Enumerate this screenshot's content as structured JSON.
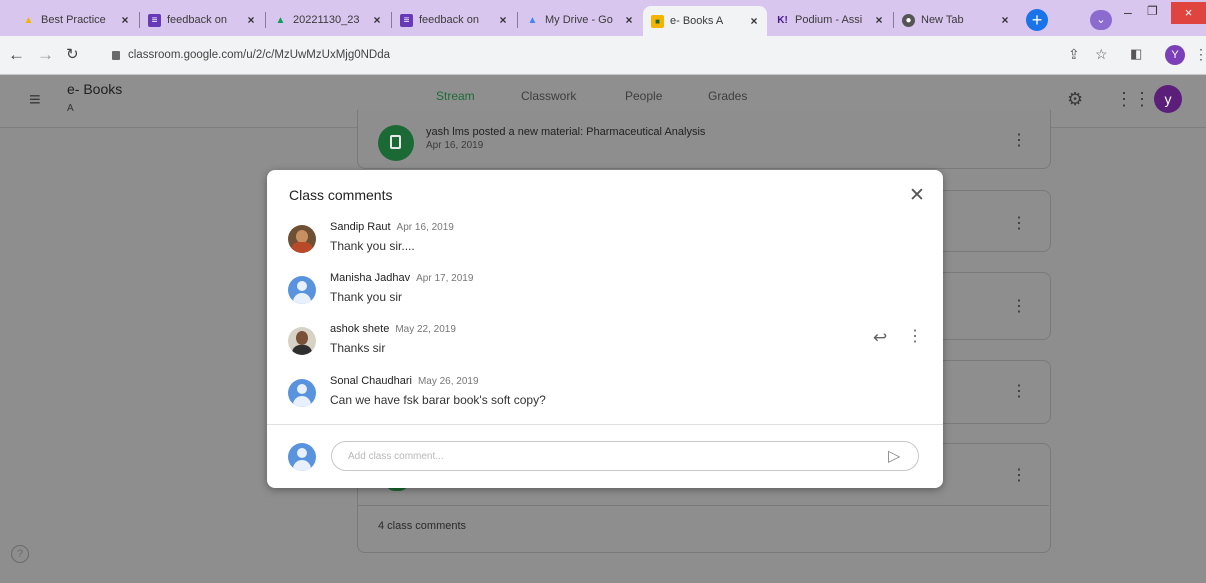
{
  "browser": {
    "tabs": [
      {
        "title": "Best Practice",
        "icon": "google-drive-icon",
        "active": false
      },
      {
        "title": "feedback on",
        "icon": "google-forms-icon",
        "active": false
      },
      {
        "title": "20221130_23",
        "icon": "google-drive-icon",
        "active": false
      },
      {
        "title": "feedback on",
        "icon": "google-forms-icon",
        "active": false
      },
      {
        "title": "My Drive - Go",
        "icon": "google-drive-icon",
        "active": false
      },
      {
        "title": "e- Books A",
        "icon": "google-classroom-icon",
        "active": true
      },
      {
        "title": "Podium - Assi",
        "icon": "kahoot-icon",
        "active": false
      },
      {
        "title": "New Tab",
        "icon": "chrome-icon",
        "active": false
      }
    ],
    "new_tab_symbol": "+",
    "url": "classroom.google.com/u/2/c/MzUwMzUxMjg0NDda",
    "profile_initial": "Y"
  },
  "classroom": {
    "class_name": "e- Books",
    "section": "A",
    "nav_tabs": [
      "Stream",
      "Classwork",
      "People",
      "Grades"
    ],
    "active_tab": "Stream",
    "user_initial": "y"
  },
  "post": {
    "text": "yash lms posted a new material: Pharmaceutical Analysis",
    "date": "Apr 16, 2019",
    "comments_count": "4 class comments"
  },
  "modal": {
    "title": "Class comments",
    "comments": [
      {
        "author": "Sandip Raut",
        "date": "Apr 16, 2019",
        "text": "Thank you sir....",
        "avatar": "photo"
      },
      {
        "author": "Manisha Jadhav",
        "date": "Apr 17, 2019",
        "text": "Thank you sir",
        "avatar": "default"
      },
      {
        "author": "ashok shete",
        "date": "May 22, 2019",
        "text": "Thanks sir",
        "avatar": "photo"
      },
      {
        "author": "Sonal Chaudhari",
        "date": "May 26, 2019",
        "text": "Can we have fsk barar book's soft copy?",
        "avatar": "default"
      }
    ],
    "input_placeholder": "Add class comment..."
  },
  "colors": {
    "accent_green": "#1e6b3a",
    "tab_strip": "#d9c6ee",
    "profile_purple": "#5b1f7a"
  }
}
